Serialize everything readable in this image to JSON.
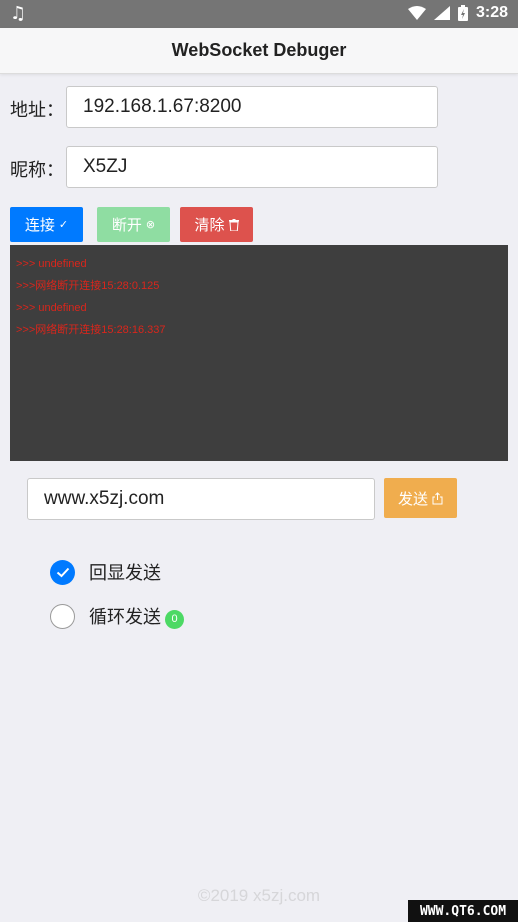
{
  "status_bar": {
    "time": "3:28"
  },
  "nav": {
    "title": "WebSocket Debuger"
  },
  "address": {
    "label": "地址：",
    "value": "192.168.1.67:8200"
  },
  "nickname": {
    "label": "昵称：",
    "value": "X5ZJ"
  },
  "buttons": {
    "connect": "连接",
    "disconnect": "断开",
    "clear": "清除",
    "send": "发送"
  },
  "log": [
    ">>> undefined",
    ">>>网络断开连接15:28:0.125",
    ">>> undefined",
    ">>>网络断开连接15:28:16.337"
  ],
  "message": {
    "value": "www.x5zj.com"
  },
  "options": {
    "echo": {
      "label": "回显发送",
      "checked": true
    },
    "loop": {
      "label": "循环发送",
      "checked": false,
      "count": "0"
    }
  },
  "footer": "©2019 x5zj.com",
  "watermark": "WWW.QT6.COM",
  "colors": {
    "primary": "#007aff",
    "success": "#8fdda2",
    "danger": "#dd524d",
    "warning": "#f0ad4e",
    "badge": "#4cd964"
  }
}
